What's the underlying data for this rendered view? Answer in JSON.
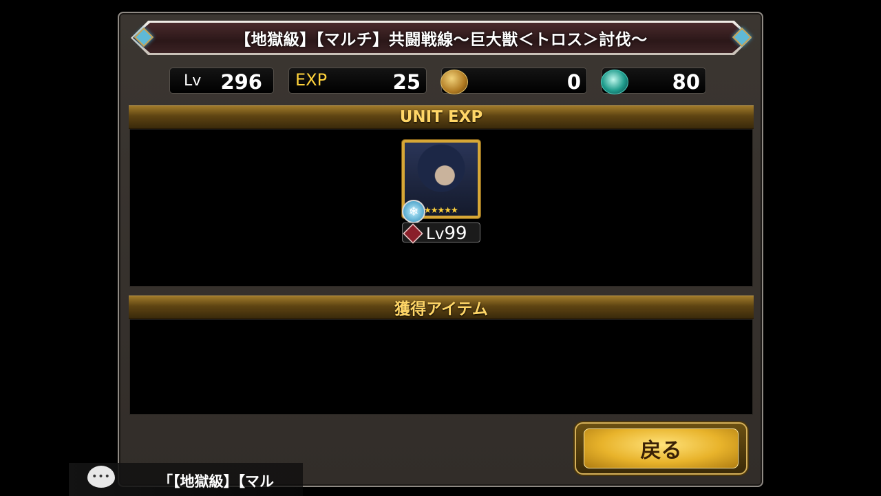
{
  "title": "【地獄級】【マルチ】共闘戦線～巨大獣＜トロス＞討伐～",
  "stats": {
    "level_label": "Lv",
    "level_value": "296",
    "exp_label": "EXP",
    "exp_value": "25",
    "gold_icon": "gold-coin-icon",
    "gold_value": "0",
    "crystal_icon": "crystal-orb-icon",
    "crystal_value": "80"
  },
  "unit_exp": {
    "header": "UNIT EXP",
    "units": [
      {
        "level_label": "Lv",
        "level": "99",
        "stars": "★★★★★",
        "element_icon": "snowflake-icon",
        "class_icon": "class-emblem-icon"
      }
    ]
  },
  "items": {
    "header": "獲得アイテム"
  },
  "back_button": "戻る",
  "chat": {
    "icon": "speech-bubble-icon",
    "text": "「【地獄級】【マル"
  },
  "colors": {
    "gold_header": "#ffd667",
    "exp_label": "#ffd23b",
    "title_band": "#3b2224"
  }
}
